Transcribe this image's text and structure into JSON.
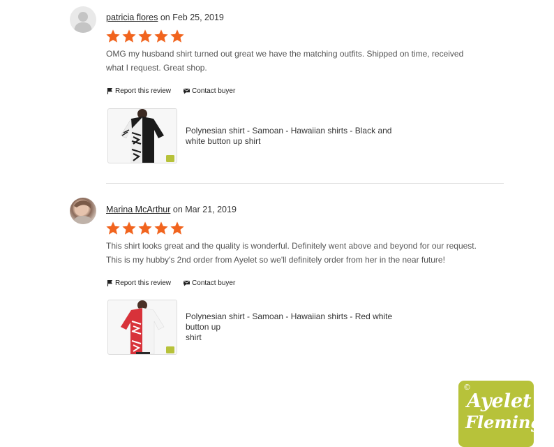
{
  "reviews": [
    {
      "reviewer": "patricia flores",
      "date_text": " on Feb 25, 2019",
      "rating": 5,
      "text_line1": "OMG my husband shirt turned out great we have the matching outfits. Shipped on time, received",
      "text_line2": "what I request. Great shop.",
      "report_label": "Report this review",
      "contact_label": "Contact buyer",
      "product_title_line1": "Polynesian shirt - Samoan - Hawaiian shirts - Black and",
      "product_title_line2": "white button up shirt"
    },
    {
      "reviewer": "Marina McArthur",
      "date_text": " on Mar 21, 2019",
      "rating": 5,
      "text_line1": "This shirt looks great and the quality is wonderful. Definitely went above and beyond for our request.",
      "text_line2": "This is my hubby's 2nd order from Ayelet so we'll definitely order from her in the near future!",
      "report_label": "Report this review",
      "contact_label": "Contact buyer",
      "product_title_line1": "Polynesian shirt - Samoan - Hawaiian shirts - Red white button up",
      "product_title_line2": "shirt"
    }
  ],
  "watermark": {
    "copyright": "©",
    "line1": "Ayelet",
    "line2": "Fleming"
  },
  "colors": {
    "star": "#F1641E",
    "accent": "#b7c23a"
  },
  "icons": {
    "report": "flag-icon",
    "contact": "message-icon",
    "rating": "star-icon"
  }
}
